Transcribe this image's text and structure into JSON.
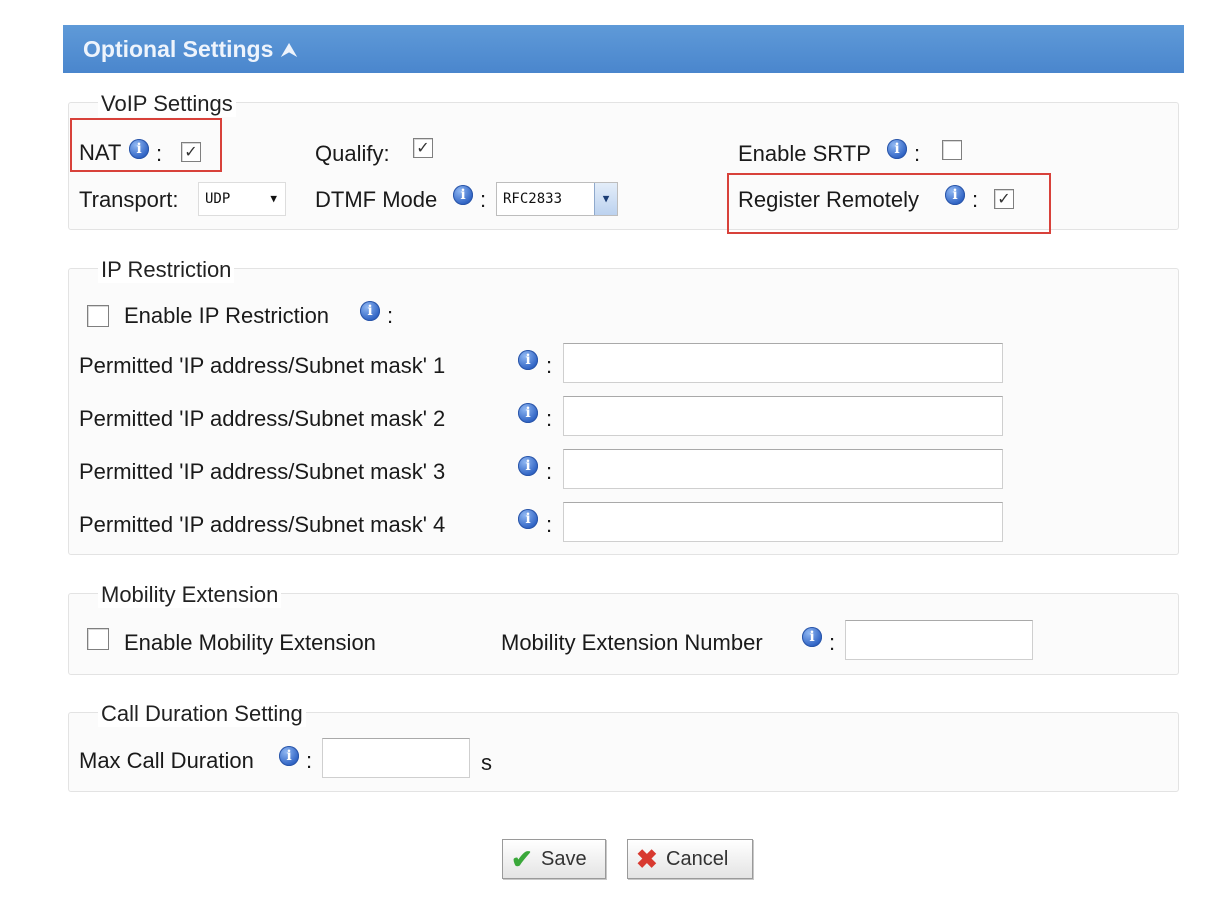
{
  "header": {
    "title": "Optional Settings",
    "chevron": "⮝"
  },
  "voip": {
    "legend": "VoIP Settings",
    "nat_label": "NAT",
    "nat_checked": true,
    "qualify_label": "Qualify:",
    "qualify_checked": true,
    "srtp_label": "Enable SRTP",
    "srtp_checked": false,
    "transport_label": "Transport:",
    "transport_value": "UDP",
    "dtmf_label": "DTMF Mode",
    "dtmf_value": "RFC2833",
    "register_label": "Register Remotely",
    "register_checked": true,
    "colon": ":"
  },
  "ip_restriction": {
    "legend": "IP Restriction",
    "enable_label": "Enable IP Restriction",
    "enable_checked": false,
    "rows": [
      {
        "label": "Permitted 'IP address/Subnet mask'  1",
        "value": ""
      },
      {
        "label": "Permitted 'IP address/Subnet mask'  2",
        "value": ""
      },
      {
        "label": "Permitted 'IP address/Subnet mask'  3",
        "value": ""
      },
      {
        "label": "Permitted 'IP address/Subnet mask'  4",
        "value": ""
      }
    ]
  },
  "mobility": {
    "legend": "Mobility Extension",
    "enable_label": "Enable Mobility Extension",
    "enable_checked": false,
    "number_label": "Mobility Extension Number",
    "number_value": ""
  },
  "call_duration": {
    "legend": "Call Duration Setting",
    "max_label": "Max Call Duration",
    "max_value": "",
    "unit": "s"
  },
  "buttons": {
    "save_label": "Save",
    "cancel_label": "Cancel"
  },
  "icons": {
    "info": "info-icon",
    "save": "checkmark-icon",
    "cancel": "x-icon"
  },
  "colors": {
    "header_bg": "#4a86cd",
    "highlight": "#d8413a",
    "info": "#2f63c4"
  }
}
